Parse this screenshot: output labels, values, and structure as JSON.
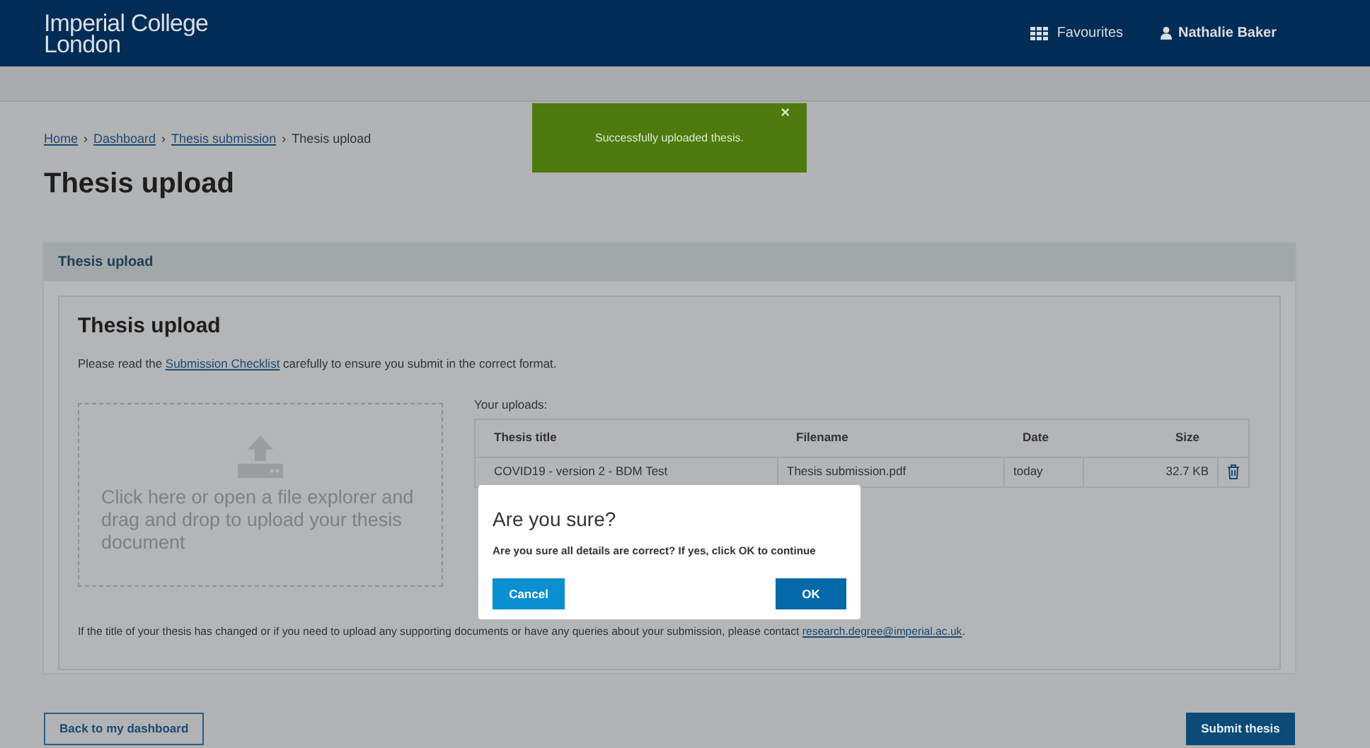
{
  "header": {
    "logo": [
      "Imperial College",
      "London"
    ],
    "favourites": "Favourites",
    "user": "Nathalie Baker"
  },
  "toast": {
    "message": "Successfully uploaded thesis.",
    "close": "×"
  },
  "breadcrumb": [
    {
      "label": "Home",
      "link": true
    },
    {
      "label": "Dashboard",
      "link": true
    },
    {
      "label": "Thesis submission",
      "link": true
    },
    {
      "label": "Thesis upload",
      "link": false
    }
  ],
  "breadcrumb_separator": "›",
  "page_title": "Thesis upload",
  "panel": {
    "title": "Thesis upload",
    "card": {
      "heading": "Thesis upload",
      "intro": {
        "before": "Please read the ",
        "link": "Submission Checklist",
        "after": " carefully to ensure you submit in the correct format."
      },
      "dropzone": "Click here or open a file explorer and drag and drop to upload your thesis document",
      "uploads_label": "Your uploads:",
      "table": {
        "columns": [
          "Thesis title",
          "Filename",
          "Date",
          "Size"
        ],
        "rows": [
          {
            "title": "COVID19 - version 2 - BDM Test",
            "filename": "Thesis submission.pdf",
            "date": "today",
            "size": "32.7 KB"
          }
        ]
      },
      "contact": {
        "before": "If the title of your thesis has changed or if you need to upload any supporting documents or have any queries about your submission, please contact ",
        "link": "research.degree@imperial.ac.uk",
        "after": "."
      }
    }
  },
  "modal": {
    "title": "Are you sure?",
    "message": "Are you sure all details are correct? If yes, click OK to continue",
    "buttons": [
      {
        "label": "Cancel",
        "kind": "secondary"
      },
      {
        "label": "OK",
        "kind": "primary"
      }
    ]
  },
  "actions": {
    "back": "Back to my dashboard",
    "submit": "Submit thesis"
  }
}
